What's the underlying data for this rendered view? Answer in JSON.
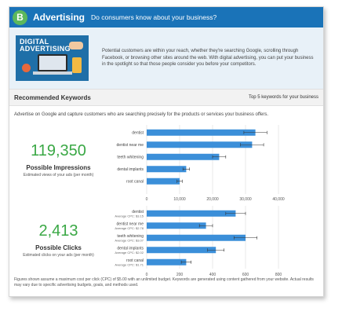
{
  "header": {
    "badge": "B",
    "title": "Advertising",
    "subtitle": "Do consumers know about your business?"
  },
  "intro": {
    "hero_title_1": "DIGITAL",
    "hero_title_2": "ADVERTISING",
    "text": "Potential customers are within your reach, whether they're searching Google, scrolling through Facebook, or browsing other sites around the web. With digital advertising, you can put your business in the spotlight so that those people consider you before your competitors."
  },
  "keywords_section": {
    "title": "Recommended Keywords",
    "right_label": "Top 5 keywords for your business",
    "description": "Advertise on Google and capture customers who are searching precisely for the products or services your business offers."
  },
  "impressions": {
    "value": "119,350",
    "label": "Possible Impressions",
    "sublabel": "Estimated views of your ads (per month)"
  },
  "clicks": {
    "value": "2,413",
    "label": "Possible Clicks",
    "sublabel": "Estimated clicks on your ads (per month)"
  },
  "footnote": "Figures shown assume a maximum cost per click (CPC) of $5.00 with an unlimited budget. Keywords are generated using content gathered from your website. Actual results may vary due to specific advertising budgets, goals, and methods used.",
  "colors": {
    "header": "#1a73b8",
    "badge": "#5cb85c",
    "accent_green": "#3aa845",
    "bar": "#3b8fd9"
  },
  "chart_data": [
    {
      "type": "bar",
      "orientation": "horizontal",
      "categories": [
        "dentist",
        "dentist near me",
        "teeth whitening",
        "dental implants",
        "root canal"
      ],
      "values": [
        33000,
        32000,
        22000,
        12000,
        10000
      ],
      "error": [
        3500,
        3500,
        2000,
        1000,
        800
      ],
      "xlim": [
        0,
        40000
      ],
      "xticks": [
        "0",
        "10,000",
        "20,000",
        "30,000",
        "40,000"
      ],
      "grid": true
    },
    {
      "type": "bar",
      "orientation": "horizontal",
      "categories": [
        "dentist",
        "dentist near me",
        "teeth whitening",
        "dental implants",
        "root canal"
      ],
      "sublabels": [
        "Average CPC: $3.15",
        "Average CPC: $2.78",
        "Average CPC: $3.07",
        "Average CPC: $2.02",
        "Average CPC: $1.71"
      ],
      "values": [
        540,
        360,
        600,
        420,
        240
      ],
      "error": [
        60,
        40,
        70,
        50,
        30
      ],
      "xlim": [
        0,
        800
      ],
      "xticks": [
        "0",
        "200",
        "400",
        "600",
        "800"
      ],
      "grid": true
    }
  ]
}
